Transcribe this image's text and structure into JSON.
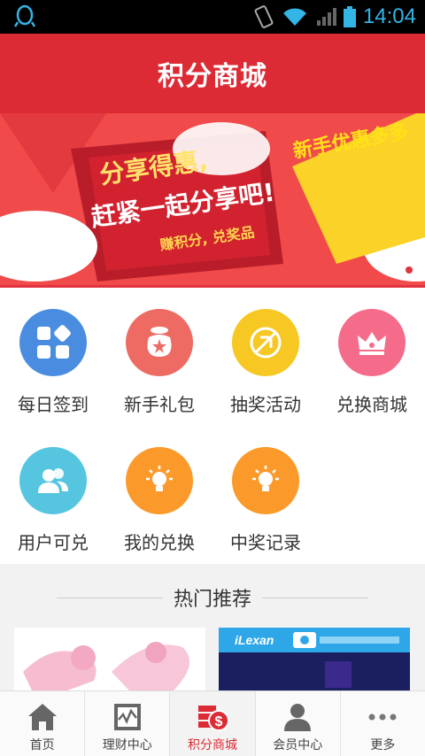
{
  "status": {
    "time": "14:04"
  },
  "header": {
    "title": "积分商城"
  },
  "banner": {
    "line1": "分享得惠,",
    "line2": "赶紧一起分享吧!",
    "line3": "赚积分, 兑奖品",
    "side": "新手优惠多多"
  },
  "menu": {
    "items": [
      {
        "label": "每日签到",
        "color": "#4a8de0",
        "icon": "grid-icon"
      },
      {
        "label": "新手礼包",
        "color": "#ee6b63",
        "icon": "money-bag-icon"
      },
      {
        "label": "抽奖活动",
        "color": "#f7c823",
        "icon": "no-compass-icon"
      },
      {
        "label": "兑换商城",
        "color": "#f56c8a",
        "icon": "crown-icon"
      },
      {
        "label": "用户可兑",
        "color": "#56c6e0",
        "icon": "users-icon"
      },
      {
        "label": "我的兑换",
        "color": "#fb9a2a",
        "icon": "lightbulb-icon"
      },
      {
        "label": "中奖记录",
        "color": "#fb9a2a",
        "icon": "lightbulb-icon"
      }
    ]
  },
  "recommend": {
    "title": "热门推荐",
    "card2_brand": "iLexan"
  },
  "tabbar": {
    "items": [
      {
        "label": "首页",
        "icon": "home-icon"
      },
      {
        "label": "理财中心",
        "icon": "chart-icon"
      },
      {
        "label": "积分商城",
        "icon": "coin-icon"
      },
      {
        "label": "会员中心",
        "icon": "user-icon"
      },
      {
        "label": "更多",
        "icon": "more-icon"
      }
    ],
    "active_index": 2
  }
}
